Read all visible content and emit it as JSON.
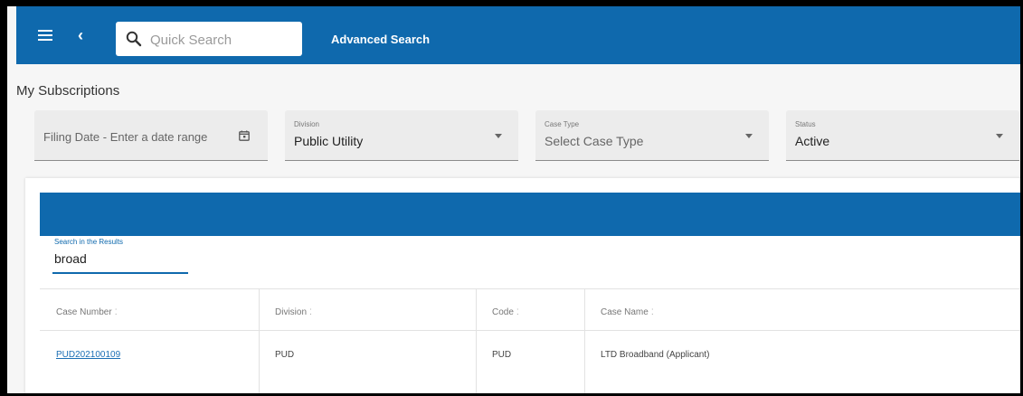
{
  "topbar": {
    "search_placeholder": "Quick Search",
    "advanced_search_label": "Advanced Search"
  },
  "page": {
    "title": "My Subscriptions"
  },
  "filters": {
    "filing_date_placeholder": "Filing Date - Enter a date range",
    "division": {
      "label": "Division",
      "value": "Public Utility"
    },
    "case_type": {
      "label": "Case Type",
      "placeholder": "Select Case Type"
    },
    "status": {
      "label": "Status",
      "value": "Active"
    }
  },
  "results": {
    "search_label": "Search in the Results",
    "search_value": "broad",
    "columns": [
      "Case Number",
      "Division",
      "Code",
      "Case Name"
    ],
    "sort_glyph": "⁚",
    "rows": [
      {
        "case_number": "PUD202100109",
        "division": "PUD",
        "code": "PUD",
        "case_name": "LTD Broadband (Applicant)"
      }
    ]
  },
  "icons": [
    "menu-icon",
    "back-chevron-icon",
    "search-icon",
    "calendar-icon",
    "chevron-down-icon"
  ],
  "colors": {
    "brand": "#0f69ad",
    "link": "#1c6fb5"
  }
}
